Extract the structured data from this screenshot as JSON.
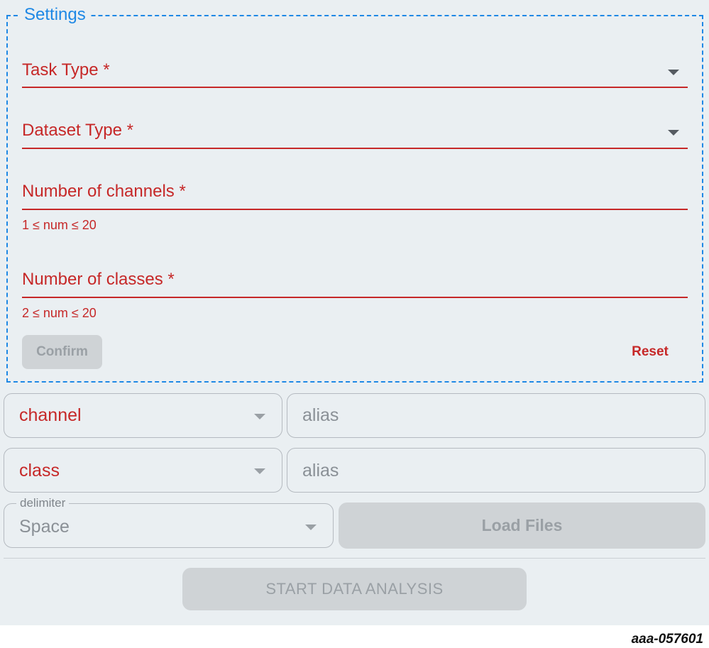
{
  "settings": {
    "legend": "Settings",
    "task_type": {
      "label": "Task Type *"
    },
    "dataset_type": {
      "label": "Dataset Type *"
    },
    "num_channels": {
      "label": "Number of channels *",
      "helper": "1 ≤ num ≤ 20"
    },
    "num_classes": {
      "label": "Number of classes *",
      "helper": "2 ≤ num ≤ 20"
    },
    "confirm_label": "Confirm",
    "reset_label": "Reset"
  },
  "mapping": {
    "channel": {
      "value": "channel",
      "alias_placeholder": "alias"
    },
    "class": {
      "value": "class",
      "alias_placeholder": "alias"
    }
  },
  "delimiter": {
    "legend": "delimiter",
    "value": "Space"
  },
  "load_files_label": "Load Files",
  "start_label": "START DATA ANALYSIS",
  "figure_id": "aaa-057601",
  "colors": {
    "accent": "#1e88e5",
    "error": "#c62828",
    "background": "#eaeff2",
    "disabled_button": "#cfd3d6"
  },
  "icons": {
    "dropdown": "chevron-down-icon"
  }
}
